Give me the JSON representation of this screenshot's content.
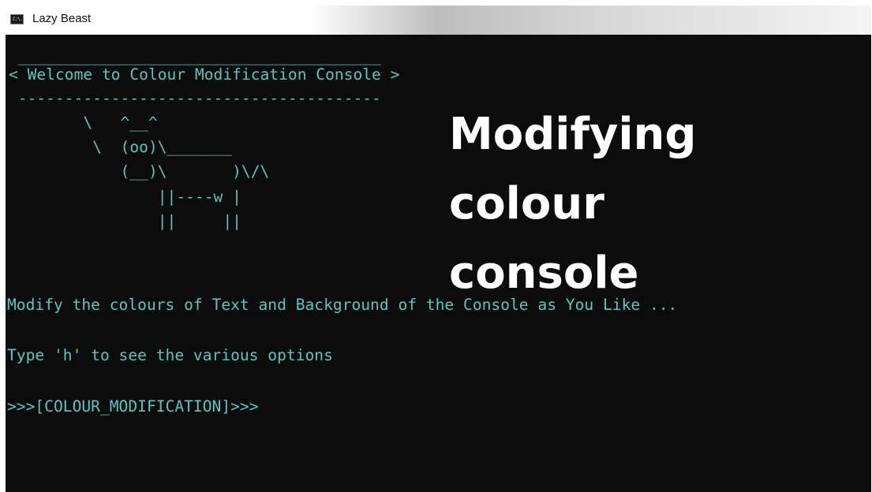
{
  "window": {
    "title": "Lazy Beast",
    "icon": "console-app-icon",
    "icon_glyph": "C:\\."
  },
  "console": {
    "banner_top": " _______________________________________",
    "banner_text": "< Welcome to Colour Modification Console >",
    "banner_bottom": " ---------------------------------------",
    "cow": [
      "        \\   ^__^",
      "         \\  (oo)\\_______",
      "            (__)\\       )\\/\\",
      "                ||----w |",
      "                ||     ||"
    ],
    "description": "Modify the colours of Text and Background of the Console as You Like ...",
    "help_hint": "Type 'h' to see the various options",
    "prompt": ">>>[COLOUR_MODIFICATION]>>>"
  },
  "overlay": {
    "line1": "Modifying",
    "line2": "colour",
    "line3": "console"
  },
  "colors": {
    "console_bg": "#0c0c0c",
    "console_text": "#5ec4c4",
    "overlay_text": "#ffffff"
  }
}
